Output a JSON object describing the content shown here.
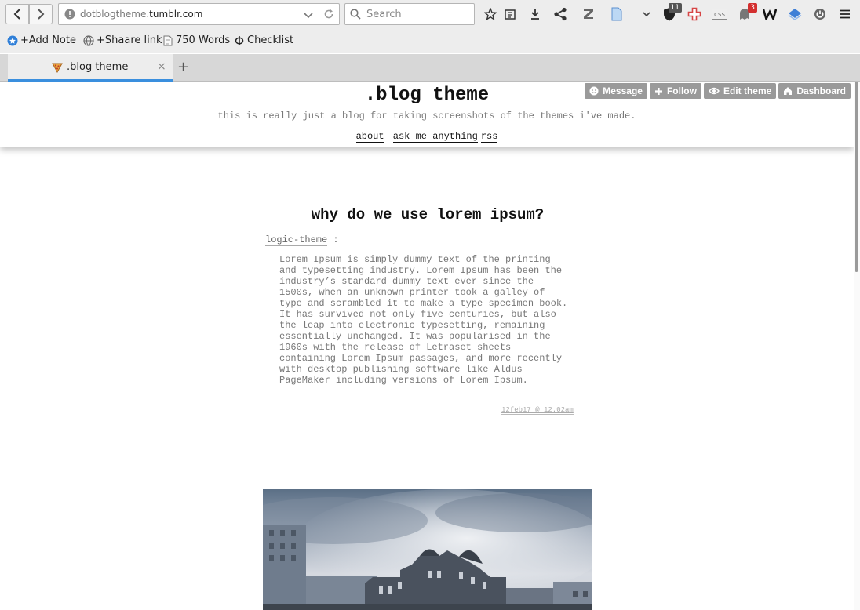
{
  "browser": {
    "url_dim": "dotblogtheme.",
    "url_bold": "tumblr.com",
    "search_placeholder": "Search",
    "badges": {
      "ublock": "11",
      "notifications": "3"
    },
    "bookmarks": [
      {
        "label": "+Add Note"
      },
      {
        "label": "+Shaare link"
      },
      {
        "label": "750 Words"
      },
      {
        "label": "Checklist"
      }
    ],
    "tab": {
      "title": ".blog theme",
      "close": "×"
    },
    "newtab": "+"
  },
  "blog": {
    "title": ".blog theme",
    "description": "this is really just a blog for taking screenshots of the themes i've made.",
    "nav": {
      "about": "about",
      "ask": "ask me anything",
      "rss": "rss"
    },
    "controls": {
      "message": "Message",
      "follow": "Follow",
      "edit": "Edit theme",
      "dashboard": "Dashboard"
    }
  },
  "post": {
    "title": "why do we use lorem ipsum?",
    "source": "logic-theme",
    "source_sep": ":",
    "quote": "Lorem Ipsum is simply dummy text of the printing and typesetting industry. Lorem Ipsum has been the industry’s standard dummy text ever since the 1500s, when an unknown printer took a galley of type and scrambled it to make a type specimen book. It has survived not only five centuries, but also the leap into electronic typesetting, remaining essentially unchanged. It was popularised in the 1960s with the release of Letraset sheets containing Lorem Ipsum passages, and more recently with desktop publishing software like Aldus PageMaker including versions of Lorem Ipsum.",
    "timestamp": "12feb17 @ 12.02am"
  },
  "colors": {
    "accent_tab": "#3a8fde",
    "tumblr_button": "#9a9a9a"
  }
}
